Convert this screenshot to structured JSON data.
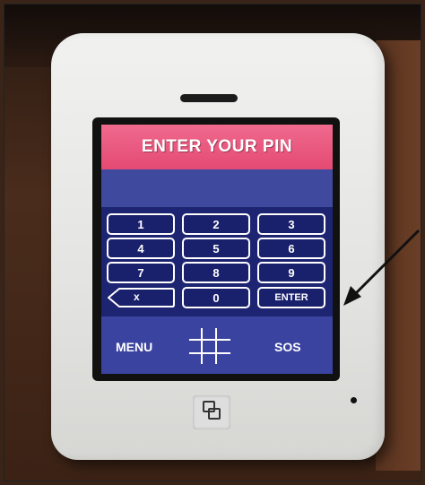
{
  "screen": {
    "header_title": "ENTER YOUR PIN",
    "keys": {
      "k1": "1",
      "k2": "2",
      "k3": "3",
      "k4": "4",
      "k5": "5",
      "k6": "6",
      "k7": "7",
      "k8": "8",
      "k9": "9",
      "k0": "0",
      "backspace": "x",
      "enter": "ENTER"
    },
    "menu_label": "MENU",
    "sos_label": "SOS",
    "center_icon": "hash-icon"
  },
  "annotation": {
    "icon": "arrow-icon",
    "color": "#111111"
  },
  "colors": {
    "header_pink": "#e44a73",
    "screen_blue": "#39429b",
    "keypad_navy": "#1d2472"
  }
}
